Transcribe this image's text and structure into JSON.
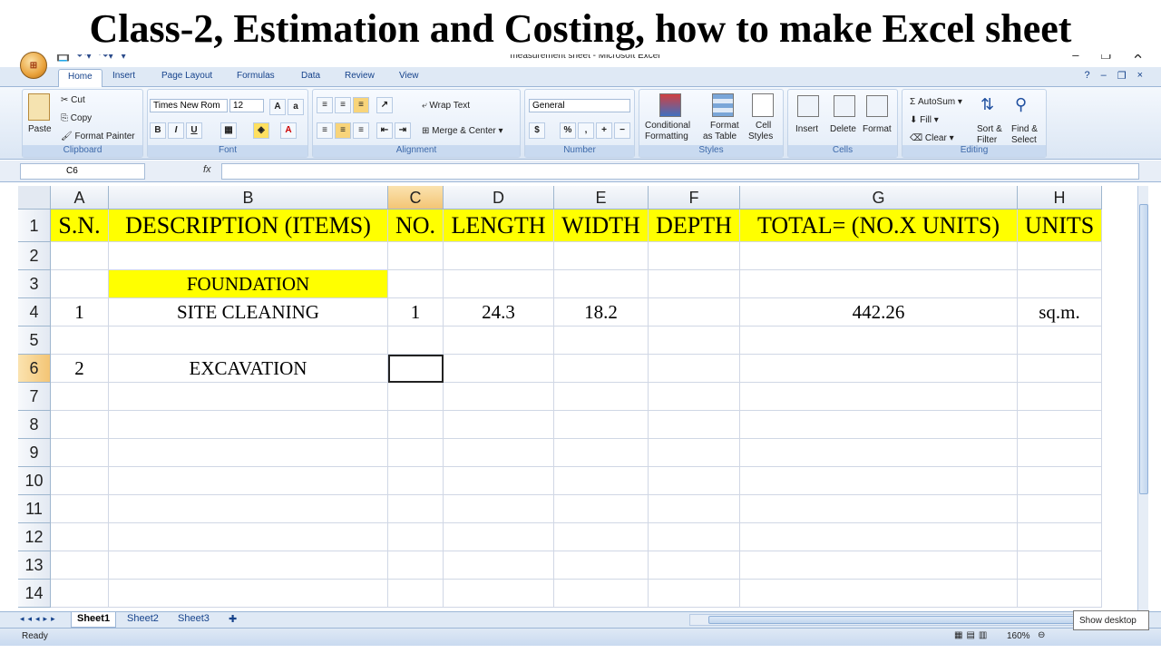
{
  "overlay_title": "Class-2, Estimation and Costing, how to make Excel sheet",
  "window": {
    "title": "measurement sheet - Microsoft Excel",
    "controls": [
      "–",
      "❐",
      "✕"
    ]
  },
  "ribbon": {
    "tabs": [
      "Home",
      "Insert",
      "Page Layout",
      "Formulas",
      "Data",
      "Review",
      "View"
    ],
    "active_tab": "Home",
    "clipboard": {
      "label": "Clipboard",
      "paste": "Paste",
      "cut": "Cut",
      "copy": "Copy",
      "format_painter": "Format Painter"
    },
    "font": {
      "label": "Font",
      "name": "Times New Rom",
      "size": "12"
    },
    "alignment": {
      "label": "Alignment",
      "wrap": "Wrap Text",
      "merge": "Merge & Center"
    },
    "number": {
      "label": "Number",
      "format": "General"
    },
    "styles": {
      "label": "Styles",
      "conditional": "Conditional",
      "conditional2": "Formatting",
      "format_table": "Format",
      "format_table2": "as Table",
      "cell_styles": "Cell",
      "cell_styles2": "Styles"
    },
    "cells": {
      "label": "Cells",
      "insert": "Insert",
      "delete": "Delete",
      "format": "Format"
    },
    "editing": {
      "label": "Editing",
      "autosum": "AutoSum",
      "fill": "Fill",
      "clear": "Clear",
      "sort": "Sort &",
      "sort2": "Filter",
      "find": "Find &",
      "find2": "Select"
    }
  },
  "formula_bar": {
    "name_box": "C6",
    "fx": "fx",
    "value": ""
  },
  "grid": {
    "columns": [
      "A",
      "B",
      "C",
      "D",
      "E",
      "F",
      "G",
      "H"
    ],
    "selected_column": "C",
    "selected_row": 6,
    "rows": [
      {
        "num": "1",
        "cells": [
          "S.N.",
          "DESCRIPTION (ITEMS)",
          "NO.",
          "LENGTH",
          "WIDTH",
          "DEPTH",
          "TOTAL= (NO.X UNITS)",
          "UNITS"
        ]
      },
      {
        "num": "2",
        "cells": [
          "",
          "",
          "",
          "",
          "",
          "",
          "",
          ""
        ]
      },
      {
        "num": "3",
        "cells": [
          "",
          "FOUNDATION",
          "",
          "",
          "",
          "",
          "",
          ""
        ]
      },
      {
        "num": "4",
        "cells": [
          "1",
          "SITE CLEANING",
          "1",
          "24.3",
          "18.2",
          "",
          "442.26",
          "sq.m."
        ]
      },
      {
        "num": "5",
        "cells": [
          "",
          "",
          "",
          "",
          "",
          "",
          "",
          ""
        ]
      },
      {
        "num": "6",
        "cells": [
          "2",
          "EXCAVATION",
          "",
          "",
          "",
          "",
          "",
          ""
        ]
      },
      {
        "num": "7",
        "cells": [
          "",
          "",
          "",
          "",
          "",
          "",
          "",
          ""
        ]
      },
      {
        "num": "8",
        "cells": [
          "",
          "",
          "",
          "",
          "",
          "",
          "",
          ""
        ]
      },
      {
        "num": "9",
        "cells": [
          "",
          "",
          "",
          "",
          "",
          "",
          "",
          ""
        ]
      },
      {
        "num": "10",
        "cells": [
          "",
          "",
          "",
          "",
          "",
          "",
          "",
          ""
        ]
      },
      {
        "num": "11",
        "cells": [
          "",
          "",
          "",
          "",
          "",
          "",
          "",
          ""
        ]
      },
      {
        "num": "12",
        "cells": [
          "",
          "",
          "",
          "",
          "",
          "",
          "",
          ""
        ]
      },
      {
        "num": "13",
        "cells": [
          "",
          "",
          "",
          "",
          "",
          "",
          "",
          ""
        ]
      },
      {
        "num": "14",
        "cells": [
          "",
          "",
          "",
          "",
          "",
          "",
          "",
          ""
        ]
      }
    ]
  },
  "sheets": [
    "Sheet1",
    "Sheet2",
    "Sheet3"
  ],
  "active_sheet": "Sheet1",
  "status": {
    "ready": "Ready",
    "zoom": "160%"
  },
  "tooltip": "Show desktop",
  "colors": {
    "header_fill": "#ffff00",
    "ribbon_text": "#15428b"
  }
}
